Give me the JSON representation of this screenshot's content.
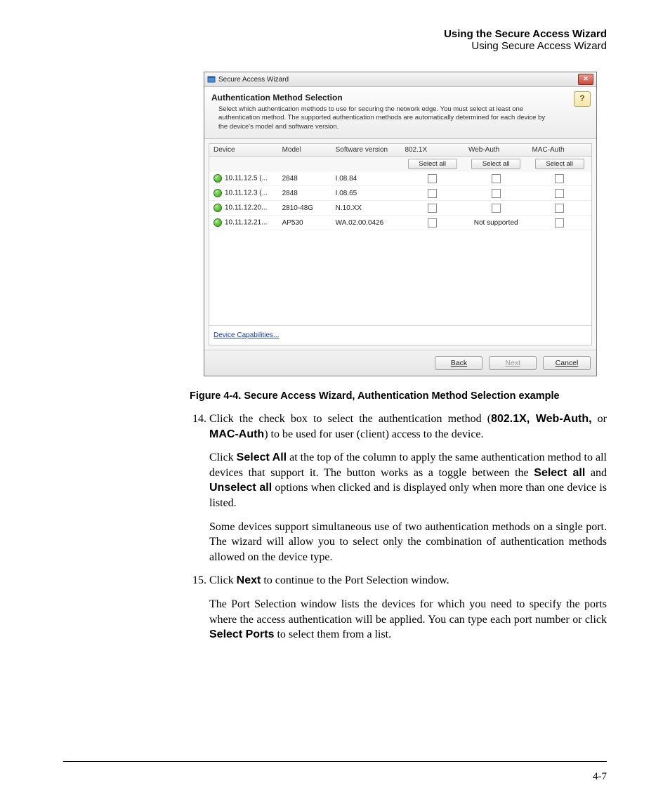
{
  "header": {
    "bold": "Using the Secure Access Wizard",
    "light": "Using Secure Access Wizard"
  },
  "wizard": {
    "title": "Secure Access Wizard",
    "section_title": "Authentication Method Selection",
    "description": "Select which authentication methods to use for securing the network edge. You must select at least one authentication method. The supported authentication methods are automatically determined for each device by the device's model and software version.",
    "help_label": "?",
    "close_label": "✕",
    "columns": {
      "device": "Device",
      "model": "Model",
      "swver": "Software version",
      "dot1x": "802.1X",
      "webauth": "Web-Auth",
      "macauth": "MAC-Auth"
    },
    "select_all": "Select all",
    "not_supported": "Not supported",
    "rows": [
      {
        "device": "10.11.12.5 (...",
        "model": "2848",
        "swver": "I.08.84",
        "webauth": "checkbox"
      },
      {
        "device": "10.11.12.3 (...",
        "model": "2848",
        "swver": "I.08.65",
        "webauth": "checkbox"
      },
      {
        "device": "10.11.12.20...",
        "model": "2810-48G",
        "swver": "N.10.XX",
        "webauth": "checkbox"
      },
      {
        "device": "10.11.12.21...",
        "model": "AP530",
        "swver": "WA.02.00.0426",
        "webauth": "not_supported"
      }
    ],
    "device_caps_link": "Device Capabilities...",
    "buttons": {
      "back": "Back",
      "next": "Next",
      "cancel": "Cancel"
    }
  },
  "caption": "Figure 4-4. Secure Access Wizard, Authentication Method Selection example",
  "body": {
    "li14_a_pre": "Click the check box to select the authentication method (",
    "li14_a_bold1": "802.1X, Web-Auth,",
    "li14_a_mid": " or ",
    "li14_a_bold2": "MAC-Auth",
    "li14_a_post": ") to be used for user (client) access to the device.",
    "li14_b_pre": "Click ",
    "li14_b_bold1": "Select All",
    "li14_b_mid1": " at the top of the column to apply the same authentication method to all devices that support it. The button works as a toggle between the ",
    "li14_b_bold2": "Select all",
    "li14_b_mid2": " and ",
    "li14_b_bold3": "Unselect all",
    "li14_b_post": " options when clicked and is displayed only when more than one device is listed.",
    "li14_c": "Some devices support simultaneous use of two authentication methods on a single port. The wizard will allow you to select only the combination of authentication methods allowed on the device type.",
    "li15_a_pre": "Click ",
    "li15_a_bold": "Next",
    "li15_a_post": " to continue to the Port Selection window.",
    "li15_b_pre": "The Port Selection window lists the devices for which you need to specify the ports where the access authentication will be applied. You can type each port number or click ",
    "li15_b_bold": "Select Ports",
    "li15_b_post": " to select them from a list."
  },
  "page_number": "4-7"
}
